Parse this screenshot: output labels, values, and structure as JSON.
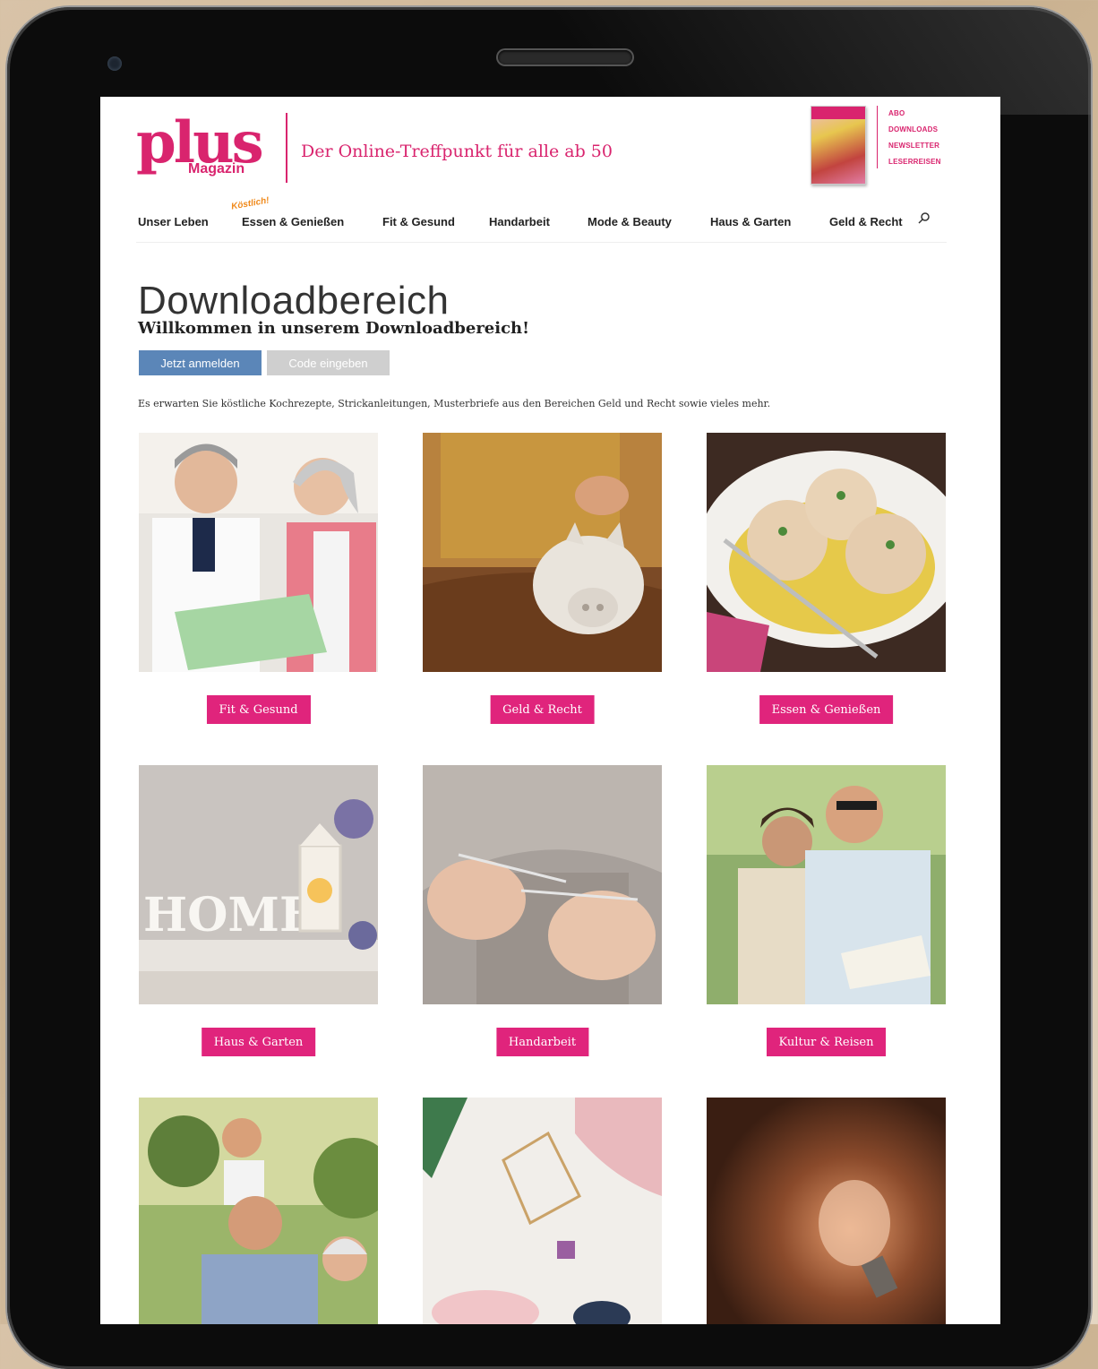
{
  "header": {
    "logo_word": "plus",
    "logo_sub": "Magazin",
    "tagline": "Der Online-Treffpunkt für alle ab 50",
    "top_links": [
      "ABO",
      "DOWNLOADS",
      "NEWSLETTER",
      "LESERREISEN"
    ]
  },
  "nav": {
    "items": [
      "Unser Leben",
      "Essen & Genießen",
      "Fit & Gesund",
      "Handarbeit",
      "Mode & Beauty",
      "Haus & Garten",
      "Geld & Recht"
    ],
    "badge": "Köstlich!"
  },
  "main": {
    "title": "Downloadbereich",
    "welcome": "Willkommen in unserem Downloadbereich!",
    "login_button": "Jetzt anmelden",
    "code_button": "Code eingeben",
    "intro": "Es erwarten Sie köstliche Kochrezepte, Strickanleitungen, Musterbriefe aus den Bereichen Geld und Recht sowie vieles mehr."
  },
  "tiles": [
    {
      "label": "Fit & Gesund",
      "image": "doctor-patient-photo"
    },
    {
      "label": "Geld & Recht",
      "image": "piggy-bank-photo"
    },
    {
      "label": "Essen & Genießen",
      "image": "dumplings-photo"
    },
    {
      "label": "Haus & Garten",
      "image": "home-decor-photo"
    },
    {
      "label": "Handarbeit",
      "image": "knitting-photo"
    },
    {
      "label": "Kultur & Reisen",
      "image": "travel-couple-photo"
    },
    {
      "label": "",
      "image": "grandparent-child-photo"
    },
    {
      "label": "",
      "image": "fashion-accessories-photo"
    },
    {
      "label": "",
      "image": "lightbulb-photo"
    }
  ],
  "colors": {
    "brand": "#d9246e",
    "button_pink": "#e0247c",
    "login_blue": "#5b86b8",
    "code_grey": "#cfcfcf"
  }
}
